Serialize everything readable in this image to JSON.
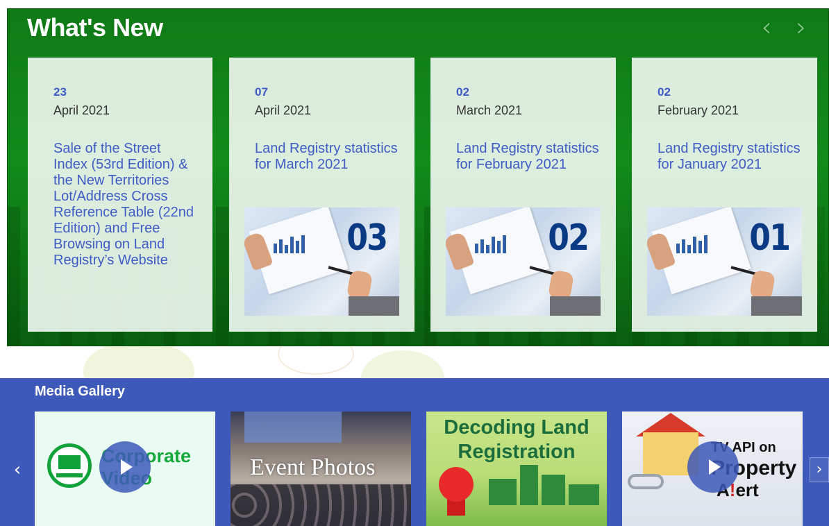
{
  "whats_new": {
    "title": "What's New",
    "prev_arrow": "‹",
    "next_arrow": "›",
    "cards": [
      {
        "day": "23",
        "month_year": "April 2021",
        "headline": "Sale of the Street Index (53rd Edition) & the New Territories Lot/Address Cross Reference Table (22nd Edition) and Free Browsing on Land Registry’s Website",
        "image_number": ""
      },
      {
        "day": "07",
        "month_year": "April 2021",
        "headline": "Land Registry statistics for March 2021",
        "image_number": "03"
      },
      {
        "day": "02",
        "month_year": "March 2021",
        "headline": "Land Registry statistics for February 2021",
        "image_number": "02"
      },
      {
        "day": "02",
        "month_year": "February 2021",
        "headline": "Land Registry statistics for January 2021",
        "image_number": "01"
      }
    ]
  },
  "media_gallery": {
    "title": "Media Gallery",
    "prev_arrow": "‹",
    "next_arrow": "›",
    "tiles": [
      {
        "line1": "Corporate",
        "line2": "Video"
      },
      {
        "line1": "Event Photos"
      },
      {
        "line1": "Decoding Land",
        "line2": "Registration"
      },
      {
        "line1": "TV API on",
        "line2": "Property",
        "line3_prefix": "A",
        "line3_mark": "!",
        "line3_suffix": "ert"
      }
    ]
  },
  "colors": {
    "whats_new_green": "#138a1c",
    "card_bg": "#ecf5ed",
    "link_blue": "#3f5bc5",
    "media_blue": "#3d59b9",
    "statistic_number_navy": "#0b3a84"
  }
}
